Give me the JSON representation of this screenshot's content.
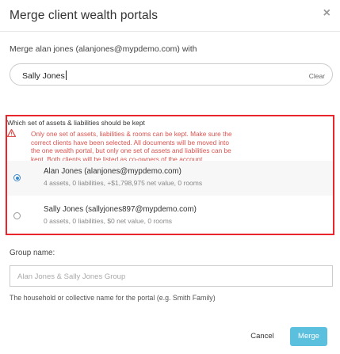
{
  "dialog": {
    "title": "Merge client wealth portals",
    "close_glyph": "×"
  },
  "merge": {
    "label": "Merge alan jones (alanjones@mypdemo.com) with",
    "search_value": "Sally Jones",
    "clear_label": "Clear"
  },
  "keep": {
    "label": "Which set of assets & liabilities should be kept",
    "warning_lines": [
      "Only one set of assets, liabilities & rooms can be kept. Make sure the",
      "correct clients have been selected. All documents will be moved into",
      "the one wealth portal, but only one set of assets and liabilities can be",
      "kept. Both clients will be listed as co-owners of the account."
    ],
    "warning_icon": "warning-triangle-icon",
    "warning_color": "#d9534f",
    "options": [
      {
        "name": "Alan Jones (alanjones@mypdemo.com)",
        "detail": "4 assets, 0 liabilities, +$1,798,975 net value, 0 rooms",
        "selected": true
      },
      {
        "name": "Sally Jones (sallyjones897@mypdemo.com)",
        "detail": "0 assets, 0 liabilities, $0 net value, 0 rooms",
        "selected": false
      }
    ]
  },
  "group": {
    "label": "Group name:",
    "placeholder": "Alan Jones & Sally Jones Group",
    "help": "The household or collective name for the portal (e.g. Smith Family)"
  },
  "footer": {
    "cancel_label": "Cancel",
    "merge_label": "Merge",
    "merge_color": "#5bc0de"
  },
  "highlight_color": "#e8262b"
}
